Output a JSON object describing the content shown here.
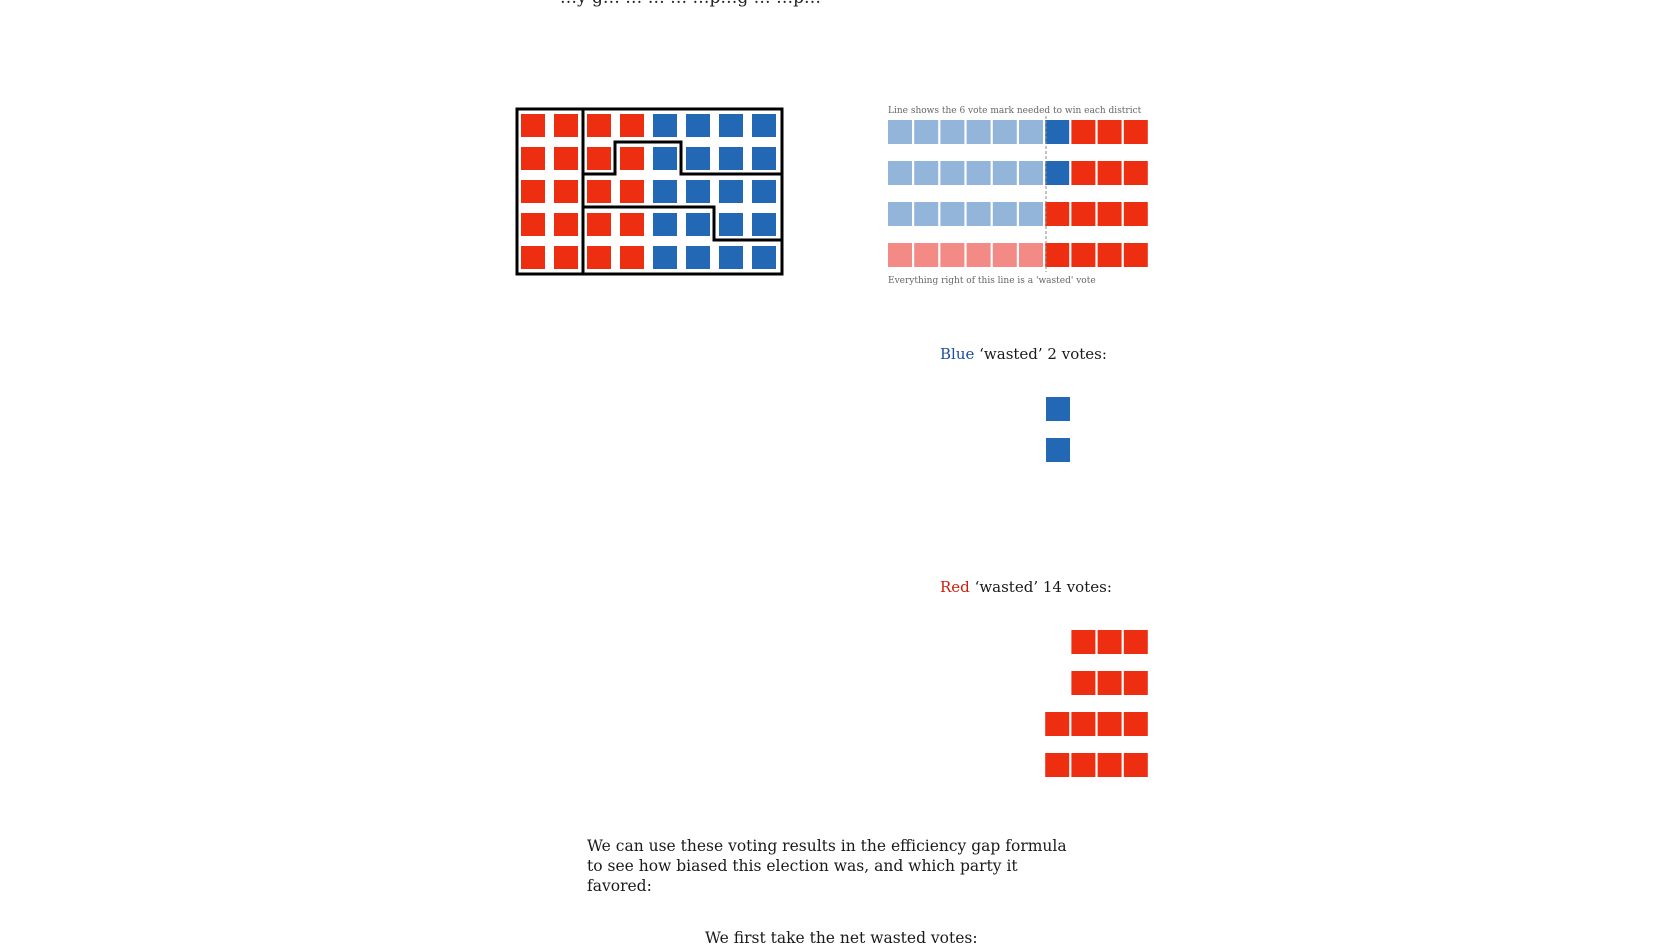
{
  "colors": {
    "red": "#ee2e10",
    "blue": "#2368b4",
    "light_blue": "#93b5da",
    "light_red": "#f38a85",
    "blue_label": "#1d4f9b",
    "red_label": "#d11c0c"
  },
  "top_cut_text": "…y g… … … … …p…g … …p…",
  "map": {
    "grid_rows": [
      [
        "red",
        "red",
        "red",
        "red",
        "blue",
        "blue",
        "blue",
        "blue"
      ],
      [
        "red",
        "red",
        "red",
        "red",
        "blue",
        "blue",
        "blue",
        "blue"
      ],
      [
        "red",
        "red",
        "red",
        "red",
        "blue",
        "blue",
        "blue",
        "blue"
      ],
      [
        "red",
        "red",
        "red",
        "red",
        "blue",
        "blue",
        "blue",
        "blue"
      ],
      [
        "red",
        "red",
        "red",
        "red",
        "blue",
        "blue",
        "blue",
        "blue"
      ]
    ]
  },
  "threshold_chart": {
    "top_note": "Line shows the 6 vote mark needed to win each district",
    "bottom_note": "Everything right of this line is a 'wasted' vote",
    "rows": [
      [
        "light_blue",
        "light_blue",
        "light_blue",
        "light_blue",
        "light_blue",
        "light_blue",
        "blue",
        "red",
        "red",
        "red"
      ],
      [
        "light_blue",
        "light_blue",
        "light_blue",
        "light_blue",
        "light_blue",
        "light_blue",
        "blue",
        "red",
        "red",
        "red"
      ],
      [
        "light_blue",
        "light_blue",
        "light_blue",
        "light_blue",
        "light_blue",
        "light_blue",
        "red",
        "red",
        "red",
        "red"
      ],
      [
        "light_red",
        "light_red",
        "light_red",
        "light_red",
        "light_red",
        "light_red",
        "red",
        "red",
        "red",
        "red"
      ]
    ]
  },
  "blue_wasted": {
    "party": "Blue",
    "rest": "‘wasted’ 2 votes:",
    "rows": [
      1,
      1,
      0,
      0
    ]
  },
  "red_wasted": {
    "party": "Red",
    "rest": "‘wasted’ 14 votes:",
    "rows": [
      3,
      3,
      4,
      4
    ]
  },
  "paragraph": "We can use these voting results in the efficiency gap formula to see how biased this election was, and which party it favored:",
  "bottom_text": "We first take the net wasted votes:"
}
